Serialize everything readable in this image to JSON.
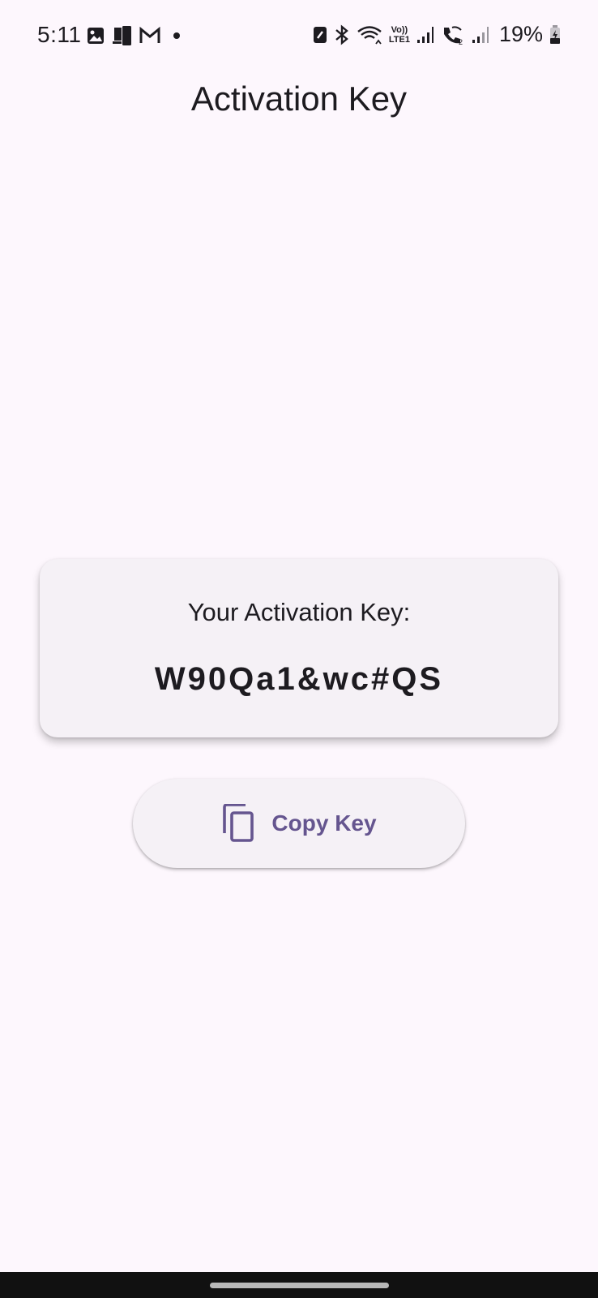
{
  "status_bar": {
    "time": "5:11",
    "battery": "19%",
    "network_label_top": "Vo))",
    "network_label_bottom": "LTE1",
    "sim2_label": "2",
    "left_icons": [
      "gallery-icon",
      "device-icon",
      "gmail-icon",
      "dot-icon"
    ],
    "right_icons": [
      "nfc-icon",
      "bluetooth-icon",
      "wifi-icon",
      "signal-icon",
      "wifi-calling-icon",
      "signal-icon",
      "battery-icon"
    ]
  },
  "app_bar": {
    "title": "Activation Key"
  },
  "card": {
    "label": "Your Activation Key:",
    "key": "W90Qa1&wc#QS"
  },
  "copy_button": {
    "label": "Copy Key",
    "icon": "copy-icon"
  },
  "colors": {
    "background": "#fdf7fd",
    "card": "#f5f1f6",
    "accent": "#65558f",
    "text": "#1d1b20"
  }
}
